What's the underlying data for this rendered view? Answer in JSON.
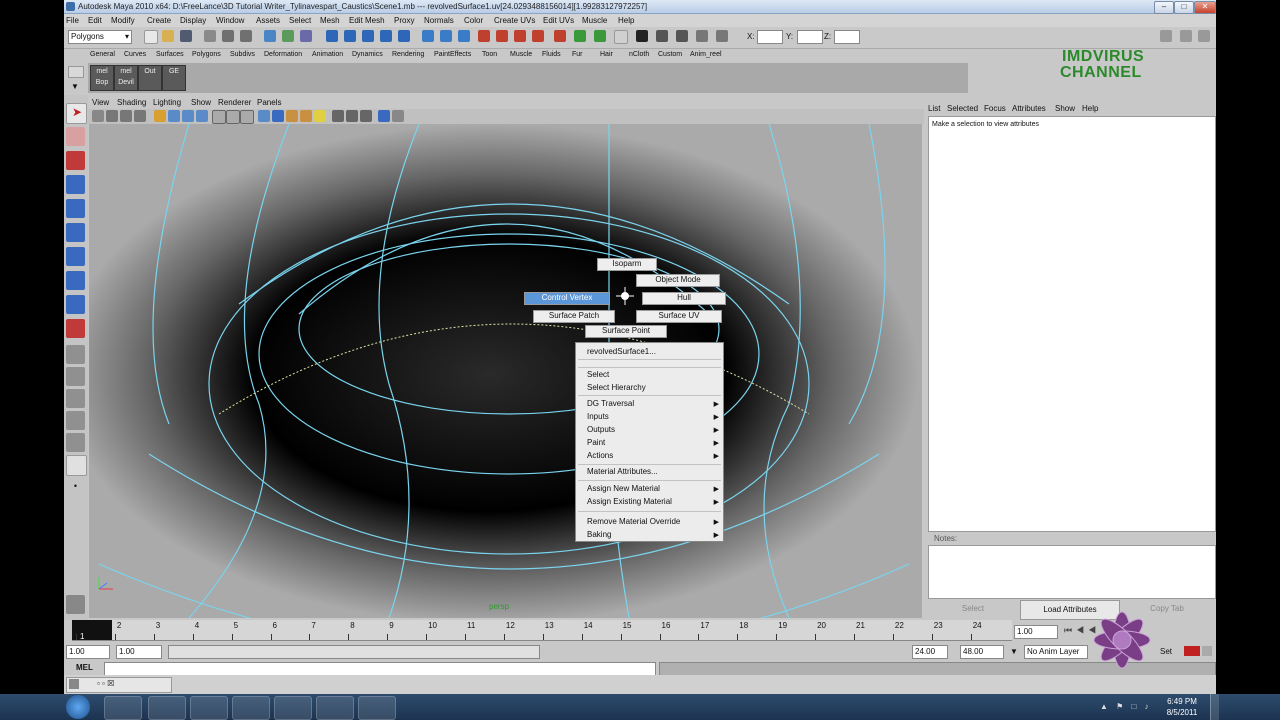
{
  "window": {
    "title": "Autodesk Maya 2010 x64: D:\\FreeLance\\3D Tutorial Writer_Tylinavespart_Caustics\\Scene1.mb  ---  revolvedSurface1.uv[24.0293488156014][1.99283127972257]"
  },
  "menubar": [
    "File",
    "Edit",
    "Modify",
    "Create",
    "Display",
    "Window",
    "Assets",
    "Select",
    "Mesh",
    "Edit Mesh",
    "Proxy",
    "Normals",
    "Color",
    "Create UVs",
    "Edit UVs",
    "Muscle",
    "Help"
  ],
  "status_line": {
    "menu_set": "Polygons",
    "x_label": "X:",
    "y_label": "Y:",
    "z_label": "Z:"
  },
  "shelf_tabs": [
    "General",
    "Curves",
    "Surfaces",
    "Polygons",
    "Subdivs",
    "Deformation",
    "Animation",
    "Dynamics",
    "Rendering",
    "PaintEffects",
    "Toon",
    "Muscle",
    "Fluids",
    "Fur",
    "Hair",
    "nCloth",
    "Custom",
    "Anim_reel"
  ],
  "shelf_buttons": [
    {
      "top": "mel",
      "bottom": "Bop"
    },
    {
      "top": "mel",
      "bottom": "Devil"
    },
    {
      "top": "",
      "bottom": "Out"
    },
    {
      "top": "",
      "bottom": "GE"
    }
  ],
  "watermark": {
    "line1": "IMDVIRUS",
    "line2": "CHANNEL"
  },
  "panel_menu": [
    "View",
    "Shading",
    "Lighting",
    "Show",
    "Renderer",
    "Panels"
  ],
  "viewport": {
    "camera": "persp"
  },
  "marking_menu": {
    "north": "Isoparm",
    "northeast": "Object Mode",
    "west": "Control Vertex",
    "east": "Hull",
    "southwest": "Surface Patch",
    "southeast": "Surface UV",
    "south": "Surface Point"
  },
  "context_menu": {
    "items": [
      {
        "label": "revolvedSurface1...",
        "sub": false
      },
      {
        "label": "Select",
        "sub": false
      },
      {
        "label": "Select Hierarchy",
        "sub": false
      },
      {
        "label": "DG Traversal",
        "sub": true
      },
      {
        "label": "Inputs",
        "sub": true
      },
      {
        "label": "Outputs",
        "sub": true
      },
      {
        "label": "Paint",
        "sub": true
      },
      {
        "label": "Actions",
        "sub": true
      },
      {
        "label": "Material Attributes...",
        "sub": false
      },
      {
        "label": "Assign New Material",
        "sub": true
      },
      {
        "label": "Assign Existing Material",
        "sub": true
      },
      {
        "label": "Remove Material Override",
        "sub": true
      },
      {
        "label": "Baking",
        "sub": true
      }
    ]
  },
  "attribute_editor": {
    "menu": [
      "List",
      "Selected",
      "Focus",
      "Attributes",
      "Show",
      "Help"
    ],
    "message": "Make a selection to view attributes",
    "notes_label": "Notes:",
    "buttons": {
      "select": "Select",
      "load": "Load Attributes",
      "copy": "Copy Tab"
    }
  },
  "timeline": {
    "ticks": [
      "1",
      "2",
      "3",
      "4",
      "5",
      "6",
      "7",
      "8",
      "9",
      "10",
      "11",
      "12",
      "13",
      "14",
      "15",
      "16",
      "17",
      "18",
      "19",
      "20",
      "21",
      "22",
      "23",
      "24"
    ],
    "current_frame": "1.00"
  },
  "range_slider": {
    "start": "1.00",
    "inner_start": "1.00",
    "inner_end": "24.00",
    "end": "48.00",
    "anim_layer": "No Anim Layer",
    "char_set": "Set"
  },
  "command_line": {
    "label": "MEL"
  },
  "taskbar": {
    "time": "6:49 PM",
    "date": "8/5/2011"
  }
}
